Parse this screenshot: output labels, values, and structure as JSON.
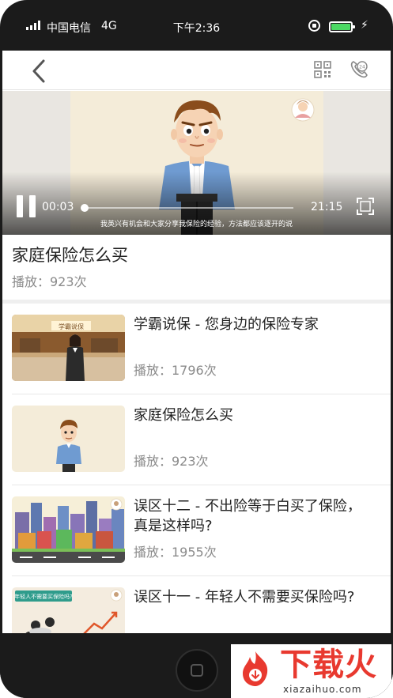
{
  "status_bar": {
    "carrier": "中国电信",
    "network": "4G",
    "time": "下午2:36",
    "battery_color": "#4cd964"
  },
  "nav": {
    "back_icon": "chevron-left-icon",
    "qr_icon": "qr-code-icon",
    "phone_icon": "phone-24h-icon"
  },
  "player": {
    "current_time": "00:03",
    "total_time": "21:15",
    "progress": 0.002,
    "subtitle": "我英兴有机会和大家分享我保险的经验，方法都应该逐开的说",
    "thumb_badge": "学霸说保"
  },
  "video_info": {
    "title": "家庭保险怎么买",
    "plays": "播放：923次"
  },
  "related": [
    {
      "title": "学霸说保 - 您身边的保险专家",
      "plays": "播放：1796次"
    },
    {
      "title": "家庭保险怎么买",
      "plays": "播放：923次"
    },
    {
      "title": "误区十二 - 不出险等于白买了保险，真是这样吗?",
      "plays": "播放：1955次"
    },
    {
      "title": "误区十一 - 年轻人不需要买保险吗?",
      "plays": "",
      "thumb_caption": "年轻人不需要买保险吗?"
    }
  ],
  "watermark": {
    "text": "下载火",
    "url": "xiazaihuo.com"
  },
  "accent_color": "#e8392f"
}
